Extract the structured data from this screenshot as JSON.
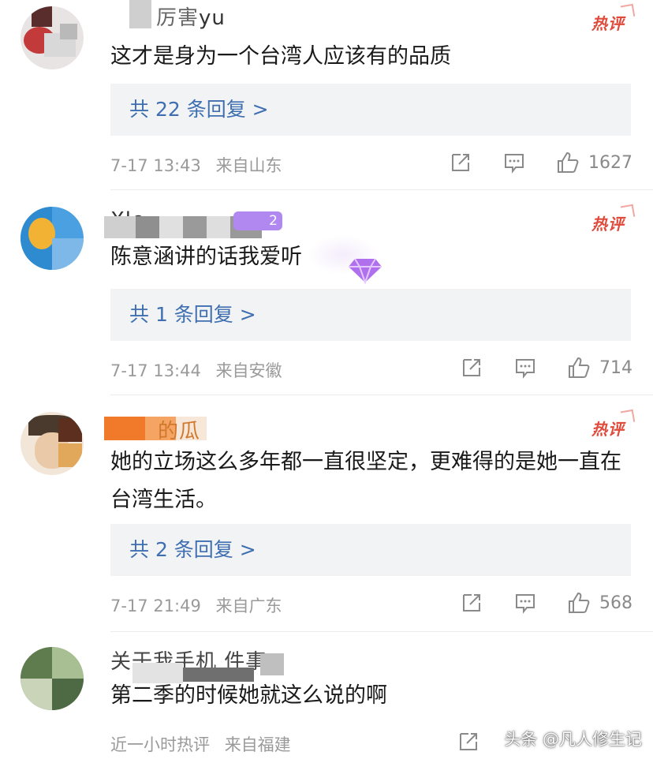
{
  "comments": [
    {
      "username": "yu",
      "username_prefix": "厉害",
      "badge": "热评",
      "text": "这才是身为一个台湾人应该有的品质",
      "reply_label": "共 22 条回复 >",
      "date": "7-17 13:43",
      "location": "来自山东",
      "likes": "1627"
    },
    {
      "username": "Xle",
      "username_level": "2",
      "badge": "热评",
      "text": "陈意涵讲的话我爱听",
      "reply_label": "共 1 条回复 >",
      "date": "7-17 13:44",
      "location": "来自安徽",
      "likes": "714"
    },
    {
      "username": "的瓜",
      "badge": "热评",
      "text": "她的立场这么多年都一直很坚定，更难得的是她一直在台湾生活。",
      "reply_label": "共 2 条回复 >",
      "date": "7-17 21:49",
      "location": "来自广东",
      "likes": "568"
    },
    {
      "username": "关于我手机 件事",
      "text": "第二季的时候她就这么说的啊",
      "date": "近一小时热评",
      "location": "来自福建"
    }
  ],
  "watermark": "头条 @凡人修生记",
  "icons": {
    "share": "share-icon",
    "comment": "comment-icon",
    "like": "thumbs-up-icon"
  },
  "colors": {
    "hot_badge": "#e04a3b",
    "reply_link": "#3f6fb0",
    "meta_gray": "#9a9a9a",
    "reply_bg": "#f2f3f5"
  }
}
